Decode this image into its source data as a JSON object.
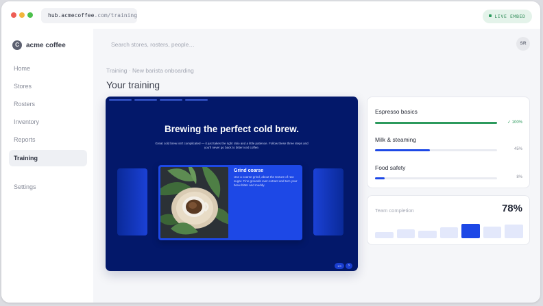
{
  "browser": {
    "url_host": "hub.acmecoffee",
    "url_path": ".com/training",
    "live_badge": "LIVE EMBED"
  },
  "brand": {
    "logo_letter": "C",
    "name": "acme coffee"
  },
  "sidebar": {
    "items": [
      {
        "label": "Home",
        "active": false
      },
      {
        "label": "Stores",
        "active": false
      },
      {
        "label": "Rosters",
        "active": false
      },
      {
        "label": "Inventory",
        "active": false
      },
      {
        "label": "Reports",
        "active": false
      },
      {
        "label": "Training",
        "active": true
      }
    ],
    "settings_label": "Settings"
  },
  "header": {
    "search_placeholder": "Search stores, rosters, people…",
    "avatar_initials": "SR"
  },
  "breadcrumb": "Training · New barista onboarding",
  "page_title": "Your training",
  "player": {
    "progress_segments": [
      1,
      1,
      1,
      1,
      0,
      0,
      0,
      0
    ],
    "slide_title": "Brewing the perfect cold brew.",
    "slide_subtitle": "Great cold brew isn't complicated — it just takes the right ratio and a little patience. Follow these three steps and you'll never go back to bitter iced coffee.",
    "card_title": "Grind coarse",
    "card_text": "Use a coarse grind, about the texture of raw sugar. Fine grounds over-extract and turn your brew bitter and muddy.",
    "slide_counter": "1/3",
    "next_icon": "chevron-right-icon"
  },
  "courses": [
    {
      "name": "Espresso basics",
      "progress": 1.0,
      "percent_label": "✓ 100%",
      "color": "#2c9a5d",
      "complete": true
    },
    {
      "name": "Milk & steaming",
      "progress": 0.45,
      "percent_label": "45%",
      "color": "#1d48e6",
      "complete": false
    },
    {
      "name": "Food safety",
      "progress": 0.08,
      "percent_label": "8%",
      "color": "#1d48e6",
      "complete": false
    }
  ],
  "team": {
    "label": "Team completion",
    "value": "78%",
    "bars": [
      0.3,
      0.45,
      0.4,
      0.55,
      0.75,
      0.6,
      0.7
    ],
    "highlight_index": 4,
    "bar_color": "#e3e8fb",
    "highlight_color": "#1d48e6"
  }
}
